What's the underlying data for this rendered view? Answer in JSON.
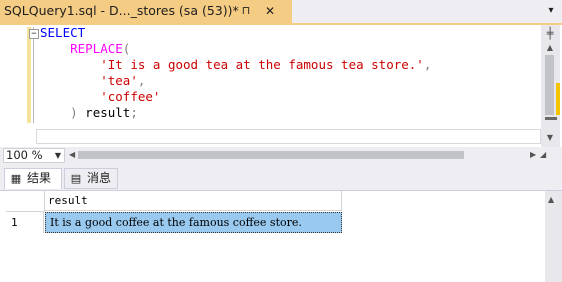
{
  "tab": {
    "title": "SQLQuery1.sql - D..._stores (sa (53))*",
    "pin_icon": "pin-icon",
    "close_icon": "close-icon"
  },
  "editor": {
    "lines": [
      {
        "indent": "",
        "parts": [
          [
            "kw",
            "SELECT"
          ]
        ]
      },
      {
        "indent": "    ",
        "parts": [
          [
            "fn",
            "REPLACE"
          ],
          [
            "gray",
            "("
          ]
        ]
      },
      {
        "indent": "        ",
        "parts": [
          [
            "str",
            "'It is a good tea at the famous tea store.'"
          ],
          [
            "gray",
            ","
          ]
        ]
      },
      {
        "indent": "        ",
        "parts": [
          [
            "str",
            "'tea'"
          ],
          [
            "gray",
            ","
          ]
        ]
      },
      {
        "indent": "        ",
        "parts": [
          [
            "str",
            "'coffee'"
          ]
        ]
      },
      {
        "indent": "    ",
        "parts": [
          [
            "gray",
            ")"
          ],
          [
            "plain",
            " result"
          ],
          [
            "gray",
            ";"
          ]
        ]
      }
    ]
  },
  "zoom": {
    "value": "100 %"
  },
  "results_tabs": {
    "results_label": "结果",
    "messages_label": "消息"
  },
  "grid": {
    "column": "result",
    "rows": [
      {
        "num": "1",
        "value": "It is a good coffee at the famous coffee store."
      }
    ]
  }
}
